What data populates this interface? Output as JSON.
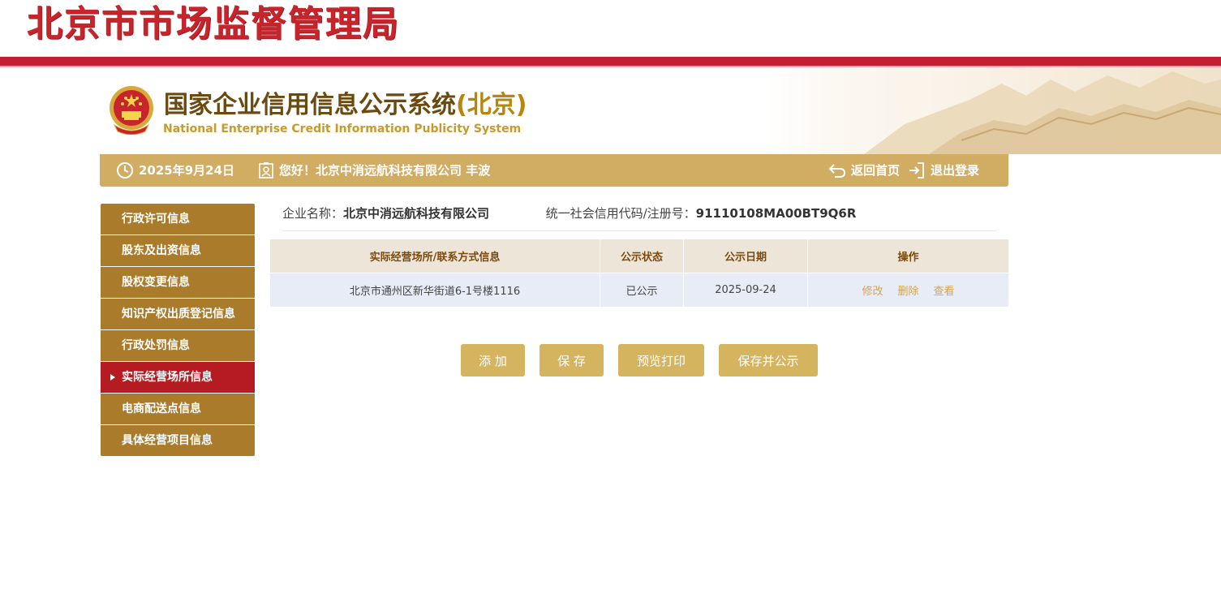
{
  "header": {
    "agency_title": "北京市市场监督管理局",
    "system_title": "国家企业信用信息公示系统",
    "system_title_region": "(北京)",
    "system_subtitle": "National Enterprise Credit Information Publicity System"
  },
  "info_bar": {
    "date": "2025年9月24日",
    "greeting": "您好！北京中消远航科技有限公司 丰波",
    "home_label": "返回首页",
    "logout_label": "退出登录"
  },
  "sidebar": {
    "items": [
      {
        "label": "行政许可信息",
        "active": false
      },
      {
        "label": "股东及出资信息",
        "active": false
      },
      {
        "label": "股权变更信息",
        "active": false
      },
      {
        "label": "知识产权出质登记信息",
        "active": false
      },
      {
        "label": "行政处罚信息",
        "active": false
      },
      {
        "label": "实际经营场所信息",
        "active": true
      },
      {
        "label": "电商配送点信息",
        "active": false
      },
      {
        "label": "具体经营项目信息",
        "active": false
      }
    ]
  },
  "company": {
    "name_label": "企业名称：",
    "name": "北京中消远航科技有限公司",
    "code_label": "统一社会信用代码/注册号：",
    "code": "91110108MA00BT9Q6R"
  },
  "table": {
    "headers": [
      "实际经营场所/联系方式信息",
      "公示状态",
      "公示日期",
      "操作"
    ],
    "rows": [
      {
        "address": "北京市通州区新华街道6-1号楼1116",
        "status": "已公示",
        "date": "2025-09-24",
        "ops": [
          "修改",
          "删除",
          "查看"
        ]
      }
    ]
  },
  "buttons": {
    "add": "添 加",
    "save": "保 存",
    "preview": "预览打印",
    "save_publish": "保存并公示"
  },
  "colors": {
    "red": "#c21f32",
    "gold_bar": "#d1ac63",
    "sidebar_brown": "#a97b2b",
    "sidebar_active": "#b51c22",
    "button_gold": "#d5b45f"
  }
}
